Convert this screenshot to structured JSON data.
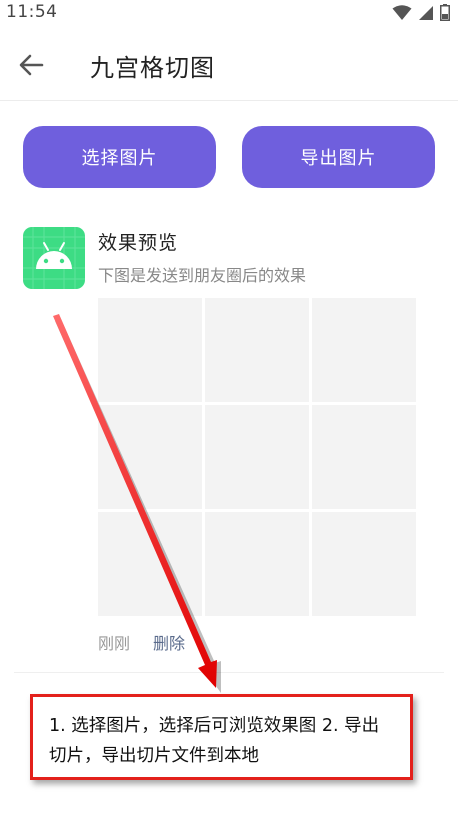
{
  "status_bar": {
    "time": "11:54",
    "icons": [
      "wifi-icon",
      "signal-icon",
      "battery-icon"
    ]
  },
  "app_bar": {
    "back_icon": "arrow-left-icon",
    "title": "九宫格切图"
  },
  "actions": {
    "select_label": "选择图片",
    "export_label": "导出图片",
    "accent_color": "#6f5fdd"
  },
  "preview": {
    "icon": "android-icon",
    "title": "效果预览",
    "subtitle": "下图是发送到朋友圈后的效果",
    "cells": [
      "",
      "",
      "",
      "",
      "",
      "",
      "",
      "",
      ""
    ],
    "time_label": "刚刚",
    "delete_label": "删除"
  },
  "annotation": {
    "text": "1. 选择图片，选择后可浏览效果图 2. 导出切片，导出切片文件到本地",
    "border_color": "#e3201b"
  }
}
